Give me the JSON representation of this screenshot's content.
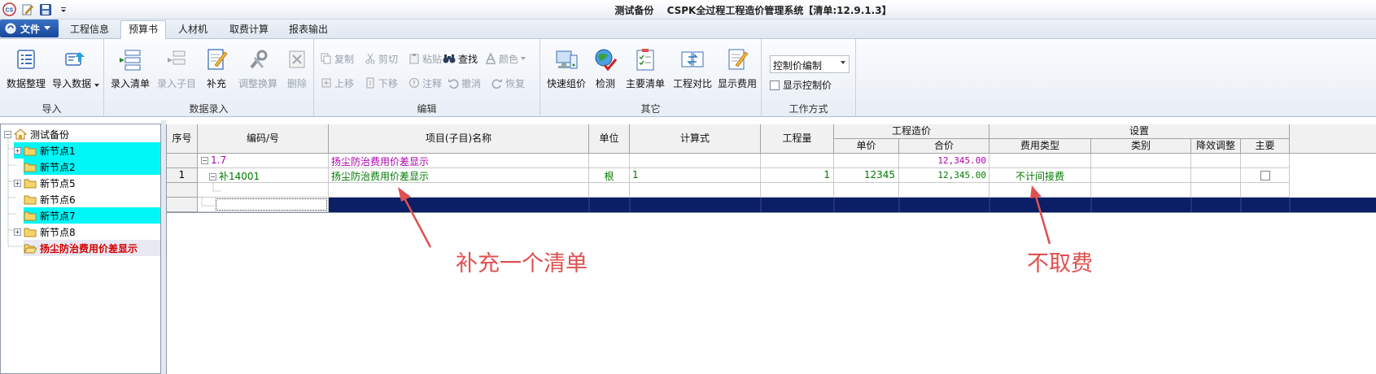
{
  "window": {
    "doc_name": "测试备份",
    "app_title": "CSPK全过程工程造价管理系统【清单:12.9.1.3】"
  },
  "tabs": {
    "file": "文件",
    "items": [
      "工程信息",
      "预算书",
      "人材机",
      "取费计算",
      "报表输出"
    ],
    "active": "预算书"
  },
  "ribbon": {
    "import": {
      "label": "导入",
      "buttons": [
        "数据整理",
        "导入数据"
      ]
    },
    "data_entry": {
      "label": "数据录入",
      "buttons": [
        "录入清单",
        "录入子目",
        "补充",
        "调整换算",
        "删除"
      ]
    },
    "edit": {
      "label": "编辑",
      "row1": [
        "复制",
        "剪切",
        "粘贴",
        "查找",
        "颜色"
      ],
      "row2": [
        "上移",
        "下移",
        "注释",
        "撤消",
        "恢复"
      ]
    },
    "other": {
      "label": "其它",
      "buttons": [
        "快速组价",
        "检测",
        "主要清单",
        "工程对比",
        "显示费用"
      ]
    },
    "work_mode": {
      "label": "工作方式",
      "select_value": "控制价编制",
      "checkbox_label": "显示控制价"
    }
  },
  "tree": {
    "root": "测试备份",
    "nodes": [
      "新节点1",
      "新节点2",
      "新节点5",
      "新节点6",
      "新节点7",
      "新节点8",
      "扬尘防治费用价差显示"
    ]
  },
  "grid": {
    "headers": {
      "seq": "序号",
      "code": "编码/号",
      "name": "项目(子目)名称",
      "unit": "单位",
      "formula": "计算式",
      "qty": "工程量",
      "cost_group": "工程造价",
      "unit_price": "单价",
      "total": "合价",
      "settings_group": "设置",
      "fee_type": "费用类型",
      "category": "类别",
      "reduction": "降效调整",
      "main": "主要"
    },
    "row1": {
      "code": "1.7",
      "name": "扬尘防治费用价差显示",
      "total": "12,345.00"
    },
    "row2": {
      "seq": "1",
      "code": "补14001",
      "name": "扬尘防治费用价差显示",
      "unit": "根",
      "formula": "1",
      "qty": "1",
      "unit_price": "12345",
      "total": "12,345.00",
      "fee_type": "不计间接费"
    }
  },
  "annotations": {
    "left": "补充一个清单",
    "right": "不取费"
  },
  "colors": {
    "highlight": "#00f7f7",
    "annotation": "#e05050",
    "navy_row": "#0a1f66",
    "pink_text": "#b000b0",
    "green_text": "#007a00"
  }
}
